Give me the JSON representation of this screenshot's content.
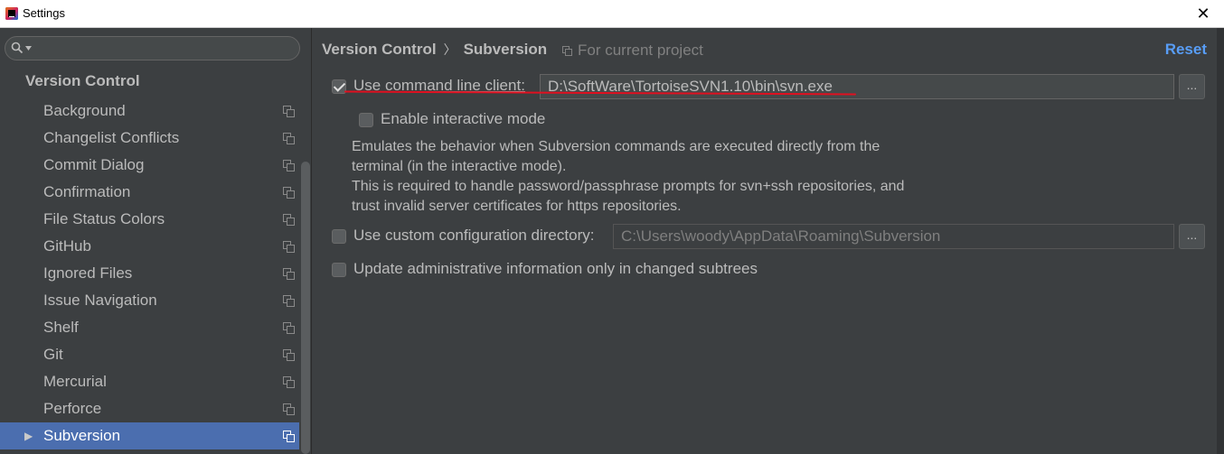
{
  "window": {
    "title": "Settings",
    "close_label": "✕"
  },
  "sidebar": {
    "search": {
      "value": "",
      "placeholder": ""
    },
    "header": "Version Control",
    "items": [
      {
        "label": "Background"
      },
      {
        "label": "Changelist Conflicts"
      },
      {
        "label": "Commit Dialog"
      },
      {
        "label": "Confirmation"
      },
      {
        "label": "File Status Colors"
      },
      {
        "label": "GitHub"
      },
      {
        "label": "Ignored Files"
      },
      {
        "label": "Issue Navigation"
      },
      {
        "label": "Shelf"
      },
      {
        "label": "Git"
      },
      {
        "label": "Mercurial"
      },
      {
        "label": "Perforce"
      },
      {
        "label": "Subversion",
        "selected": true
      }
    ],
    "expand_arrow": "▶"
  },
  "main": {
    "breadcrumb": {
      "parent": "Version Control",
      "separator": "〉",
      "current": "Subversion"
    },
    "scope": "For current project",
    "reset_label": "Reset",
    "command_line": {
      "checked": true,
      "label": "Use command line client:",
      "value": "D:\\SoftWare\\TortoiseSVN1.10\\bin\\svn.exe",
      "browse_label": "..."
    },
    "interactive": {
      "checked": false,
      "label": "Enable interactive mode"
    },
    "description": [
      "Emulates the behavior when Subversion commands are executed directly from the",
      "terminal (in the interactive mode).",
      "This is required to handle password/passphrase prompts for svn+ssh repositories, and",
      "trust invalid server certificates for https repositories."
    ],
    "config_dir": {
      "checked": false,
      "label": "Use custom configuration directory:",
      "value": "C:\\Users\\woody\\AppData\\Roaming\\Subversion",
      "browse_label": "..."
    },
    "update_admin": {
      "checked": false,
      "label": "Update administrative information only in changed subtrees"
    }
  },
  "colors": {
    "background": "#3c3f41",
    "selection": "#4b6eaf",
    "link": "#589df6",
    "annotation": "#e01020"
  },
  "icons": {
    "search": "search-icon",
    "copy": "copy-project-icon",
    "scope": "project-scope-icon"
  }
}
